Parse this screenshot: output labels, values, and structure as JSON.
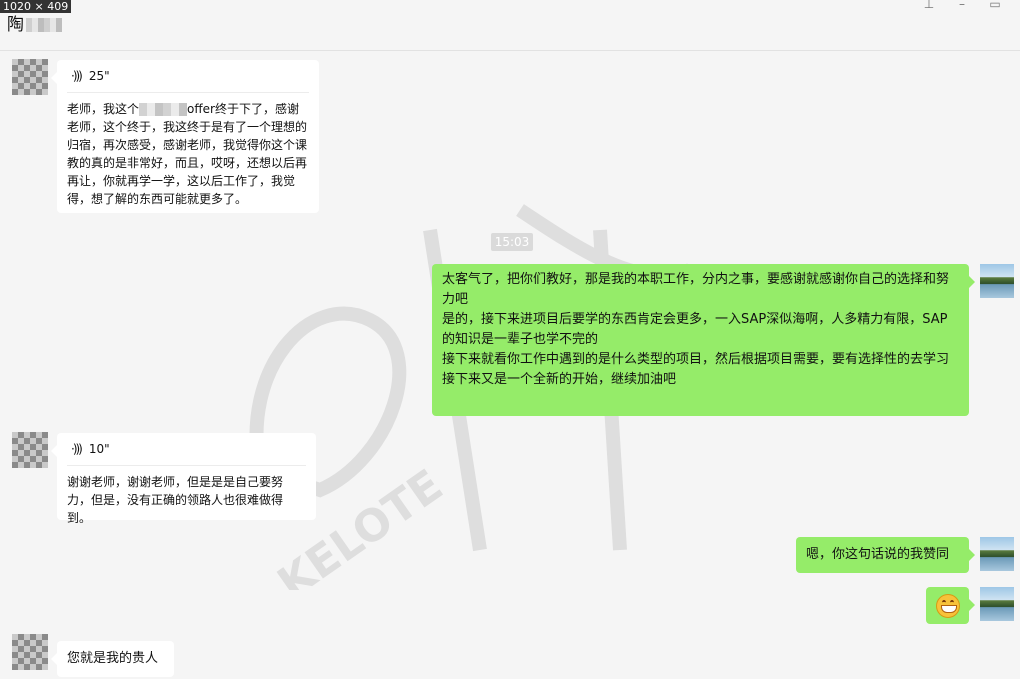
{
  "window": {
    "dim_label": "1020 × 409",
    "title": "陶"
  },
  "timestamp": "15:03",
  "watermark_text": "KELOTE",
  "messages": {
    "m1": {
      "voice_duration": "25\"",
      "transcript_a": "老师，我这个",
      "transcript_b": "offer终于下了，感谢老师，这个终于，我这终于是有了一个理想的归宿，再次感受，感谢老师，我觉得你这个课教的真的是非常好，而且，哎呀，还想以后再再让，你就再学一学，这以后工作了，我觉得，想了解的东西可能就更多了。"
    },
    "m2": {
      "line1": "太客气了，把你们教好，那是我的本职工作，分内之事，要感谢就感谢你自己的选择和努力吧",
      "line2": "是的，接下来进项目后要学的东西肯定会更多，一入SAP深似海啊，人多精力有限，SAP的知识是一辈子也学不完的",
      "line3": "接下来就看你工作中遇到的是什么类型的项目，然后根据项目需要，要有选择性的去学习",
      "line4": "接下来又是一个全新的开始，继续加油吧"
    },
    "m3": {
      "voice_duration": "10\"",
      "transcript": "谢谢老师，谢谢老师，但是是是自己要努力，但是，没有正确的领路人也很难做得到。"
    },
    "m4": {
      "text": "嗯，你这句话说的我赞同"
    },
    "m5": {
      "emoji": "grinning-face"
    },
    "m6": {
      "text": "您就是我的贵人"
    }
  }
}
